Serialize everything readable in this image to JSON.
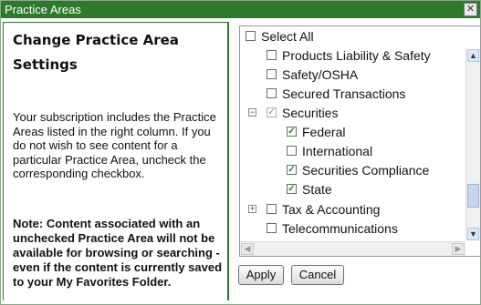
{
  "dialog": {
    "title": "Practice Areas",
    "close_glyph": "✕"
  },
  "left": {
    "heading": "Change Practice Area Settings",
    "description": "Your subscription includes the Practice Areas listed in the right column. If you do not wish to see content for a particular Practice Area, uncheck the corresponding checkbox.",
    "note": "Note: Content associated with an unchecked Practice Area will not be available for browsing or searching - even if the content is currently saved to your My Favorites Folder."
  },
  "list": {
    "select_all": "Select All",
    "items": [
      {
        "label": "Products Liability & Safety",
        "checked": false
      },
      {
        "label": "Safety/OSHA",
        "checked": false
      },
      {
        "label": "Secured Transactions",
        "checked": false
      },
      {
        "label": "Securities",
        "checked": true,
        "disabled": true,
        "expander": "−"
      },
      {
        "label": "Federal",
        "checked": true
      },
      {
        "label": "International",
        "checked": false
      },
      {
        "label": "Securities Compliance",
        "checked": true
      },
      {
        "label": "State",
        "checked": true
      },
      {
        "label": "Tax & Accounting",
        "checked": false,
        "expander": "+"
      },
      {
        "label": "Telecommunications",
        "checked": false
      }
    ]
  },
  "buttons": {
    "apply": "Apply",
    "cancel": "Cancel"
  },
  "icons": {
    "check": "✓",
    "up": "▲",
    "down": "▼",
    "left": "◀",
    "right": "▶"
  },
  "colors": {
    "title_bar": "#2d7a2d",
    "check": "#2a7a2a"
  }
}
